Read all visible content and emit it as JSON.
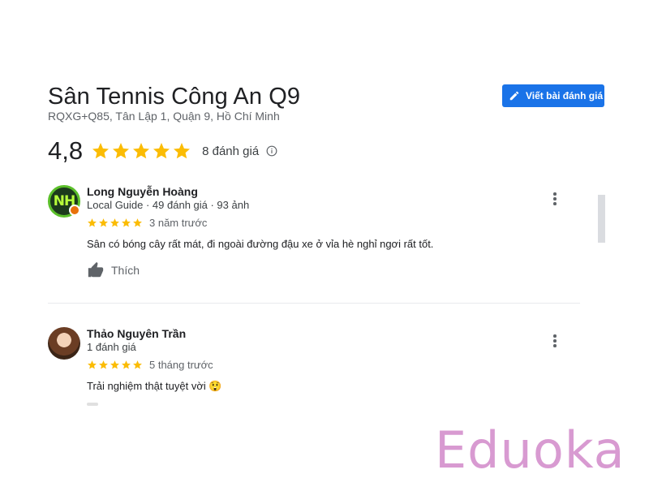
{
  "place": {
    "name": "Sân Tennis Công An Q9",
    "address": "RQXG+Q85, Tân Lập 1, Quận 9, Hồ Chí Minh",
    "rating": "4,8",
    "stars": 5,
    "review_count": "8 đánh giá"
  },
  "actions": {
    "write_review_label": "Viết bài đánh giá"
  },
  "colors": {
    "accent": "#1a73e8",
    "star": "#fbbc04",
    "watermark": "#d89ad1"
  },
  "reviews": [
    {
      "name": "Long Nguyễn Hoàng",
      "meta": "Local Guide · 49 đánh giá · 93 ảnh",
      "avatar_initials": "NH",
      "stars": 5,
      "time": "3 năm trước",
      "text": "Sân có bóng cây rất mát, đi ngoài đường đậu xe ở vỉa hè nghỉ ngơi rất tốt.",
      "like_label": "Thích"
    },
    {
      "name": "Thảo Nguyên Trần",
      "meta": "1 đánh giá",
      "stars": 5,
      "time": "5 tháng trước",
      "text": "Trải nghiệm thật tuyệt vời 😲"
    }
  ],
  "icons": {
    "write": "pencil-icon",
    "info": "info-icon",
    "like": "thumbs-up-icon",
    "more": "more-vert-icon",
    "star": "star-icon"
  },
  "watermark": "Eduoka"
}
